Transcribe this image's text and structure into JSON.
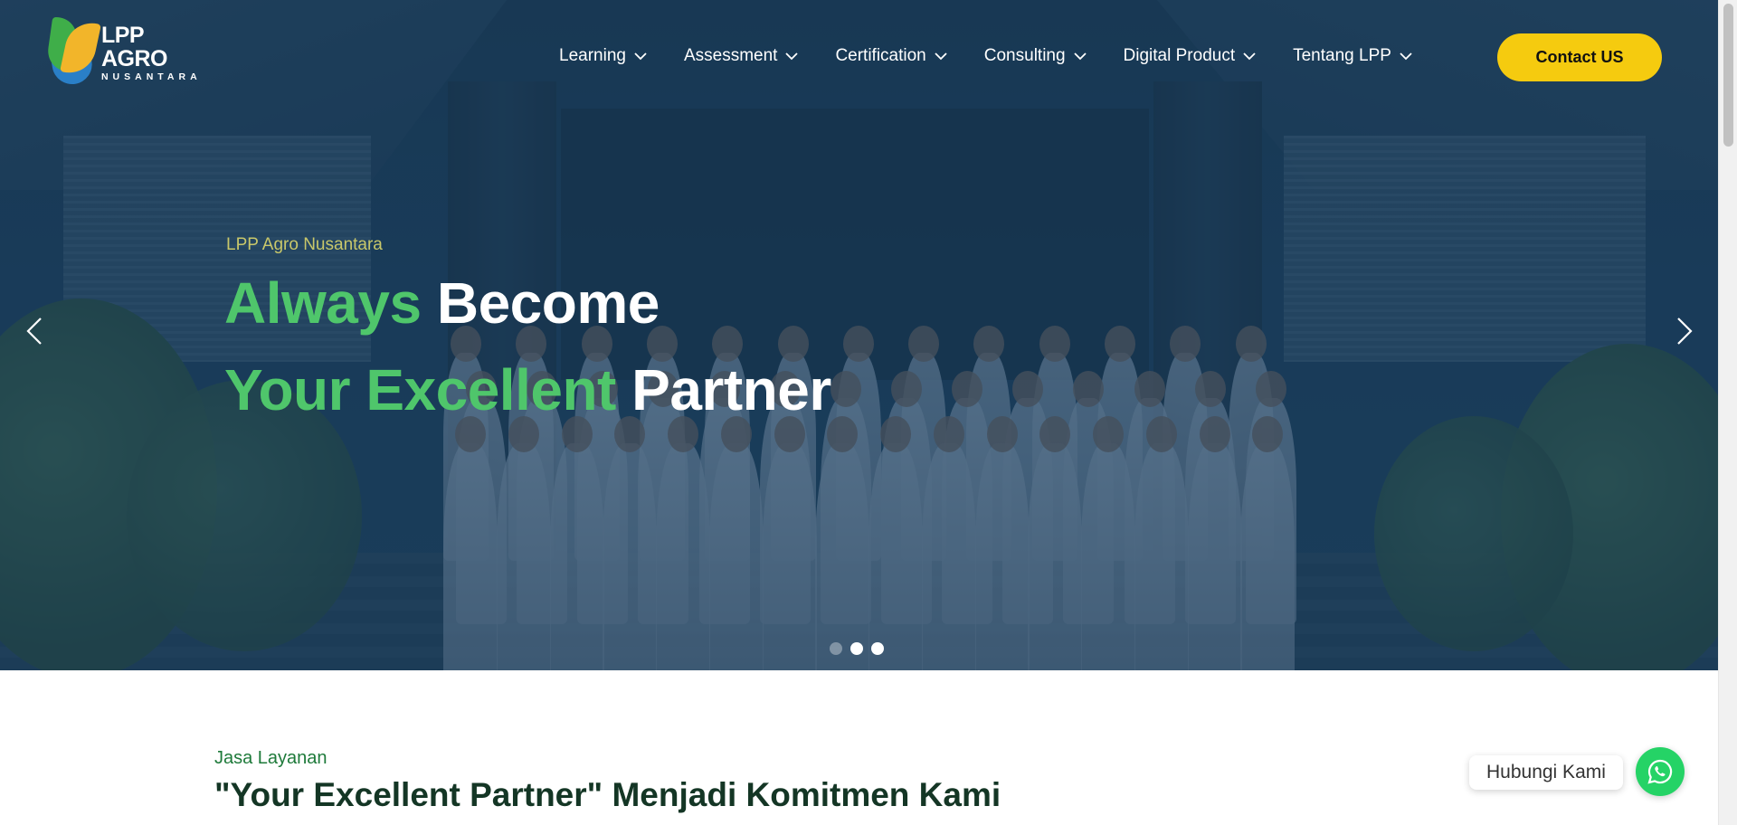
{
  "brand": {
    "logo_line1": "LPP AGRO",
    "logo_line2": "NUSANTARA"
  },
  "nav": {
    "items": [
      {
        "label": "Learning",
        "icon": "chevron-down-icon"
      },
      {
        "label": "Assessment",
        "icon": "chevron-down-icon"
      },
      {
        "label": "Certification",
        "icon": "chevron-down-icon"
      },
      {
        "label": "Consulting",
        "icon": "chevron-down-icon"
      },
      {
        "label": "Digital Product",
        "icon": "chevron-down-icon"
      },
      {
        "label": "Tentang LPP",
        "icon": "chevron-down-icon"
      }
    ],
    "contact_label": "Contact US"
  },
  "hero": {
    "kicker": "LPP Agro Nusantara",
    "line1_green": "Always",
    "line1_white": "Become",
    "line2_green": "Your Excellent",
    "line2_white": "Partner",
    "slides_total": 3,
    "active_slide": 2
  },
  "services": {
    "kicker": "Jasa Layanan",
    "title": "\"Your Excellent Partner\" Menjadi Komitmen Kami"
  },
  "whatsapp": {
    "label": "Hubungi Kami"
  },
  "colors": {
    "accent_green": "#4fc66b",
    "button_yellow": "#f5cb0f",
    "hero_overlay": "#163754",
    "whatsapp_green": "#25d366",
    "section_title": "#143625"
  }
}
